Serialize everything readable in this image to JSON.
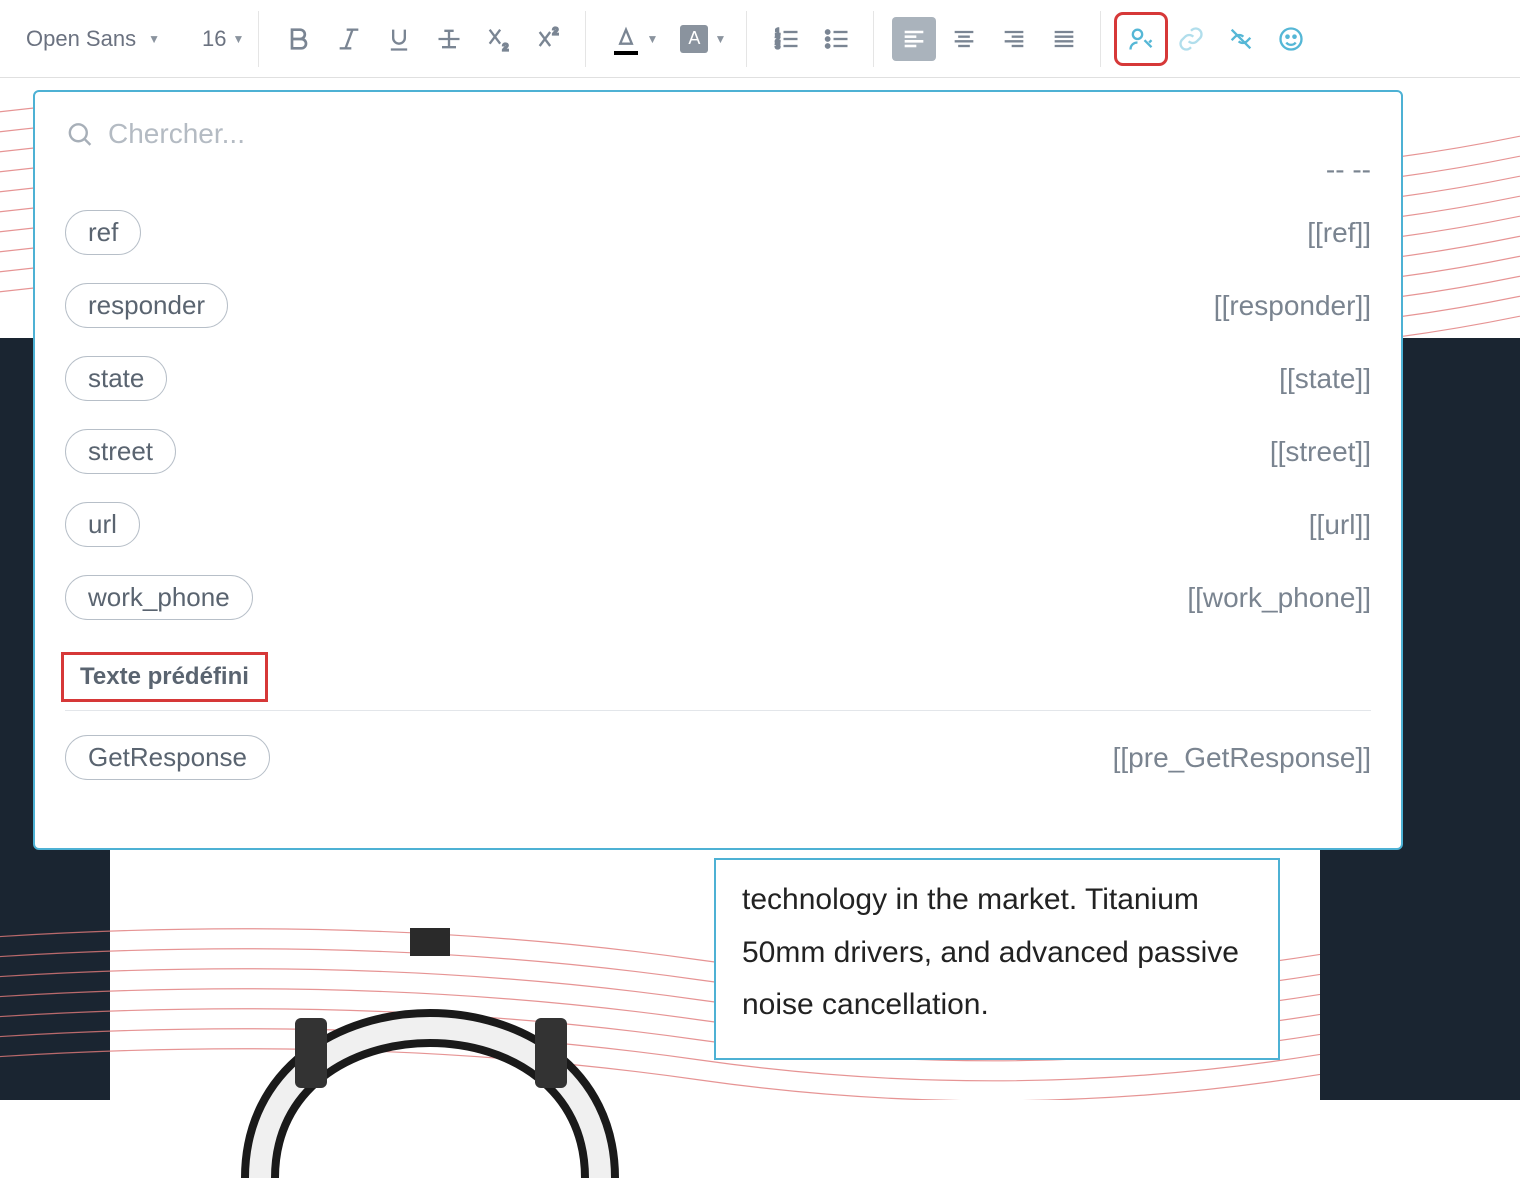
{
  "toolbar": {
    "font_family": "Open Sans",
    "font_size": "16"
  },
  "popup": {
    "search_placeholder": "Chercher...",
    "top_marker": "--   --",
    "tags": [
      {
        "label": "ref",
        "code": "[[ref]]"
      },
      {
        "label": "responder",
        "code": "[[responder]]"
      },
      {
        "label": "state",
        "code": "[[state]]"
      },
      {
        "label": "street",
        "code": "[[street]]"
      },
      {
        "label": "url",
        "code": "[[url]]"
      },
      {
        "label": "work_phone",
        "code": "[[work_phone]]"
      }
    ],
    "section_title": "Texte prédéfini",
    "predefined": [
      {
        "label": "GetResponse",
        "code": "[[pre_GetResponse]]"
      }
    ]
  },
  "product_text": "technology in the market. Titanium 50mm drivers, and advanced passive noise cancellation."
}
